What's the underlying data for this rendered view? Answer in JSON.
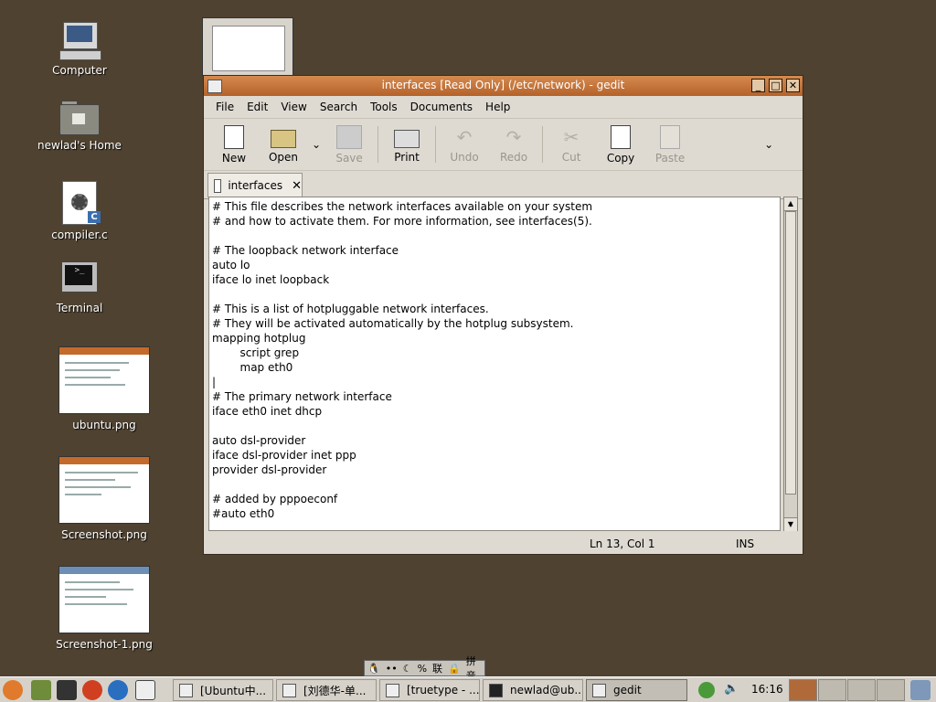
{
  "desktop": {
    "icons": [
      {
        "label": "Computer"
      },
      {
        "label": "newlad's Home"
      },
      {
        "label": "compiler.c",
        "badge": "C"
      },
      {
        "label": "Terminal"
      },
      {
        "label": "ubuntu.png"
      },
      {
        "label": "Screenshot.png"
      },
      {
        "label": "Screenshot-1.png"
      }
    ]
  },
  "window": {
    "title": "interfaces [Read Only] (/etc/network) - gedit",
    "controls": {
      "minimize": "_",
      "maximize": "□",
      "close": "✕"
    },
    "menu": [
      "File",
      "Edit",
      "View",
      "Search",
      "Tools",
      "Documents",
      "Help"
    ],
    "toolbar": {
      "new": "New",
      "open": "Open",
      "save": "Save",
      "print": "Print",
      "undo": "Undo",
      "redo": "Redo",
      "cut": "Cut",
      "copy": "Copy",
      "paste": "Paste",
      "dropdown": "⌄"
    },
    "tab": {
      "label": "interfaces",
      "close": "✕"
    },
    "content": "# This file describes the network interfaces available on your system\n# and how to activate them. For more information, see interfaces(5).\n\n# The loopback network interface\nauto lo\niface lo inet loopback\n\n# This is a list of hotpluggable network interfaces.\n# They will be activated automatically by the hotplug subsystem.\nmapping hotplug\n        script grep\n        map eth0\n|\n# The primary network interface\niface eth0 inet dhcp\n\nauto dsl-provider\niface dsl-provider inet ppp\nprovider dsl-provider\n\n# added by pppoeconf\n#auto eth0",
    "status": {
      "position": "Ln 13, Col 1",
      "mode": "INS"
    }
  },
  "imbar": {
    "items": [
      "🐧",
      "••",
      "☾",
      "%",
      "联",
      "🔒",
      "拼音"
    ]
  },
  "panel": {
    "tasks": [
      {
        "label": "[Ubuntu中..."
      },
      {
        "label": "[刘德华-单..."
      },
      {
        "label": "[truetype - ..."
      },
      {
        "label": "newlad@ub..."
      },
      {
        "label": "gedit"
      }
    ],
    "clock": "16:16",
    "volume": "🔈"
  },
  "colors": {
    "desktop": "#4f4230",
    "titlebar": "#c4733a",
    "panel": "#d6d2ca"
  }
}
